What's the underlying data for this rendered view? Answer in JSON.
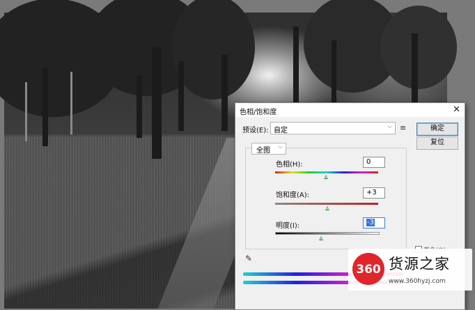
{
  "dialog": {
    "title": "色相/饱和度",
    "close": "✕",
    "preset_label": "预设(E):",
    "preset_value": "自定",
    "channel_value": "全图",
    "ok_label": "确定",
    "reset_label": "复位",
    "hue_label": "色相(H):",
    "hue_value": "0",
    "saturation_label": "饱和度(A):",
    "saturation_value": "+3",
    "lightness_label": "明度(I):",
    "lightness_value": "-3",
    "arrow": "⌵",
    "menu_icon": "≡",
    "eyedropper_icon": "✎",
    "colorize_label": "着色(O)"
  },
  "watermark": {
    "logo_text": "360",
    "name": "货源之家",
    "url": "www.360hyzj.com"
  }
}
